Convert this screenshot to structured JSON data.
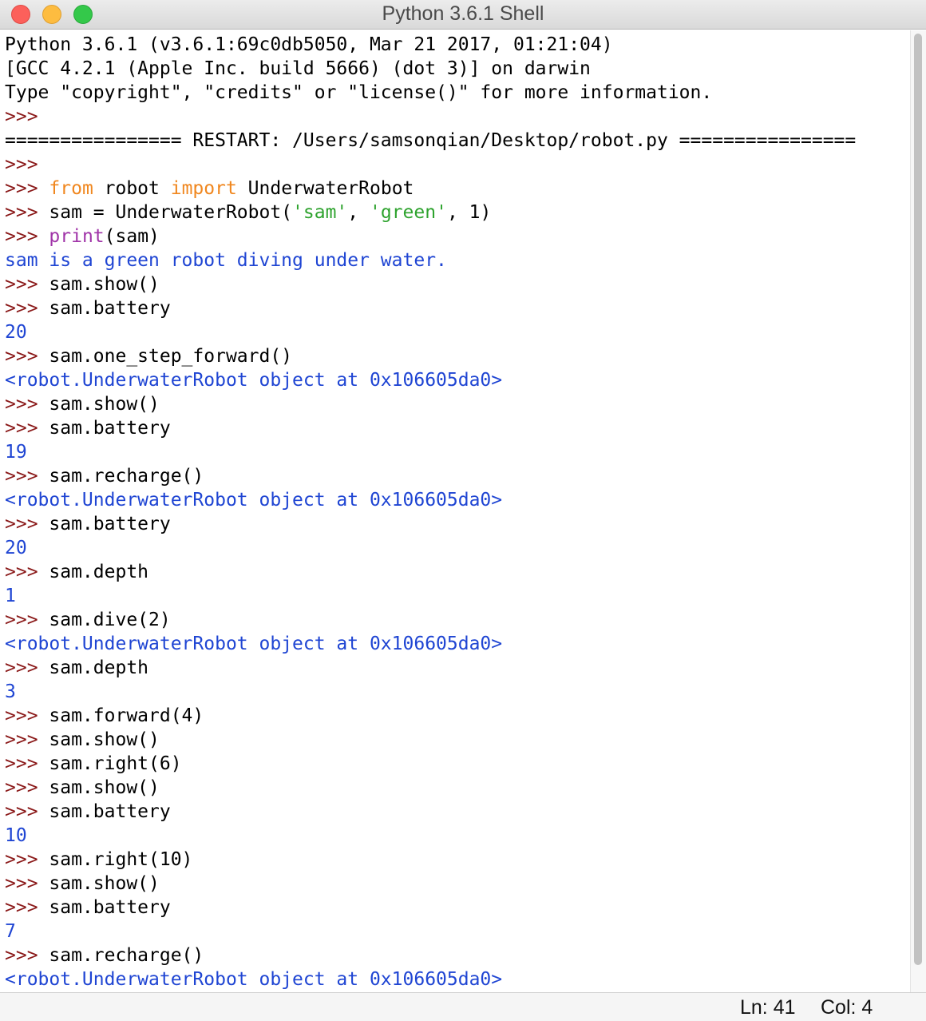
{
  "window": {
    "title": "Python 3.6.1 Shell"
  },
  "console": {
    "header": [
      "Python 3.6.1 (v3.6.1:69c0db5050, Mar 21 2017, 01:21:04)",
      "[GCC 4.2.1 (Apple Inc. build 5666) (dot 3)] on darwin",
      "Type \"copyright\", \"credits\" or \"license()\" for more information."
    ],
    "prompt": ">>>",
    "restart_line": "================ RESTART: /Users/samsonqian/Desktop/robot.py ================",
    "import_kw_from": "from",
    "import_module": " robot ",
    "import_kw_import": "import",
    "import_class": " UnderwaterRobot",
    "ctor_prefix": " sam = UnderwaterRobot(",
    "ctor_arg1": "'sam'",
    "ctor_sep": ", ",
    "ctor_arg2": "'green'",
    "ctor_suffix": ", 1)",
    "print_fn": "print",
    "print_args": "(sam)",
    "print_output": "sam is a green robot diving under water.",
    "cmd_show": " sam.show()",
    "cmd_battery": " sam.battery",
    "cmd_one_step": " sam.one_step_forward()",
    "cmd_recharge": " sam.recharge()",
    "cmd_depth": " sam.depth",
    "cmd_dive": " sam.dive(2)",
    "cmd_forward": " sam.forward(4)",
    "cmd_right6": " sam.right(6)",
    "cmd_right10": " sam.right(10)",
    "object_repr": "<robot.UnderwaterRobot object at 0x106605da0>",
    "out_20": "20",
    "out_19": "19",
    "out_1": "1",
    "out_3": "3",
    "out_10": "10",
    "out_7": "7"
  },
  "status": {
    "line": "Ln: 41",
    "col": "Col: 4"
  },
  "colors": {
    "prompt": "#8b1a1a",
    "output": "#1f45d3",
    "keyword": "#f0871f",
    "string": "#2ea32e",
    "builtin": "#a034a8"
  }
}
